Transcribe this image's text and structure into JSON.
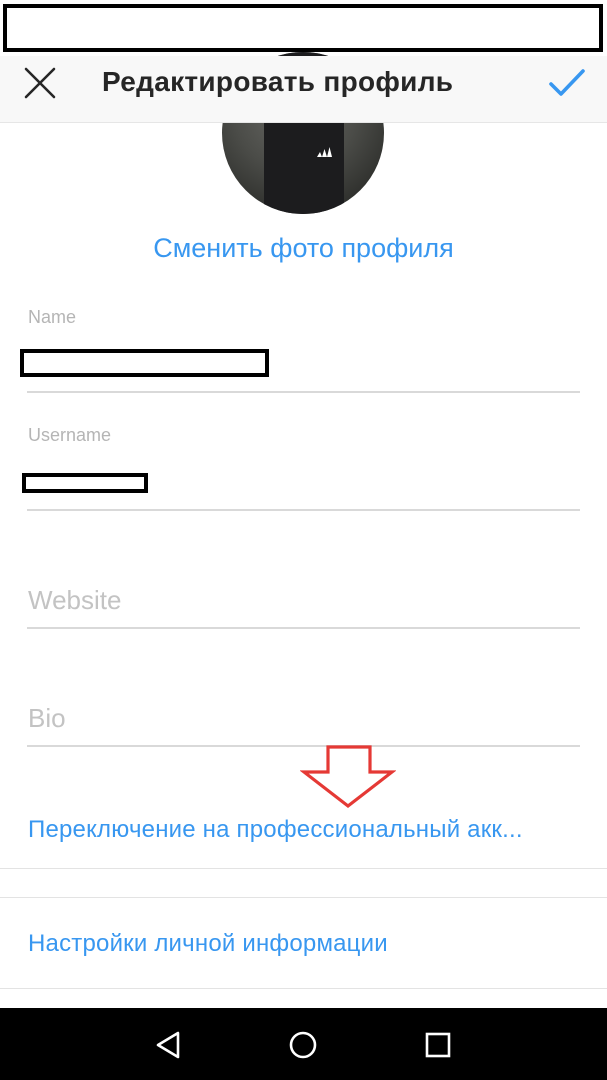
{
  "header": {
    "title": "Редактировать профиль"
  },
  "profile": {
    "change_photo_label": "Сменить фото профиля"
  },
  "fields": {
    "name_label": "Name",
    "username_label": "Username",
    "website_placeholder": "Website",
    "bio_placeholder": "Bio"
  },
  "links": {
    "switch_professional": "Переключение на профессиональный акк...",
    "personal_info": "Настройки личной информации"
  },
  "icons": {
    "close": "close-icon",
    "confirm": "check-icon",
    "back": "back-triangle-icon",
    "home": "home-circle-icon",
    "recents": "recents-square-icon"
  },
  "colors": {
    "accent": "#3897f0",
    "annotation_arrow": "#e53935"
  }
}
